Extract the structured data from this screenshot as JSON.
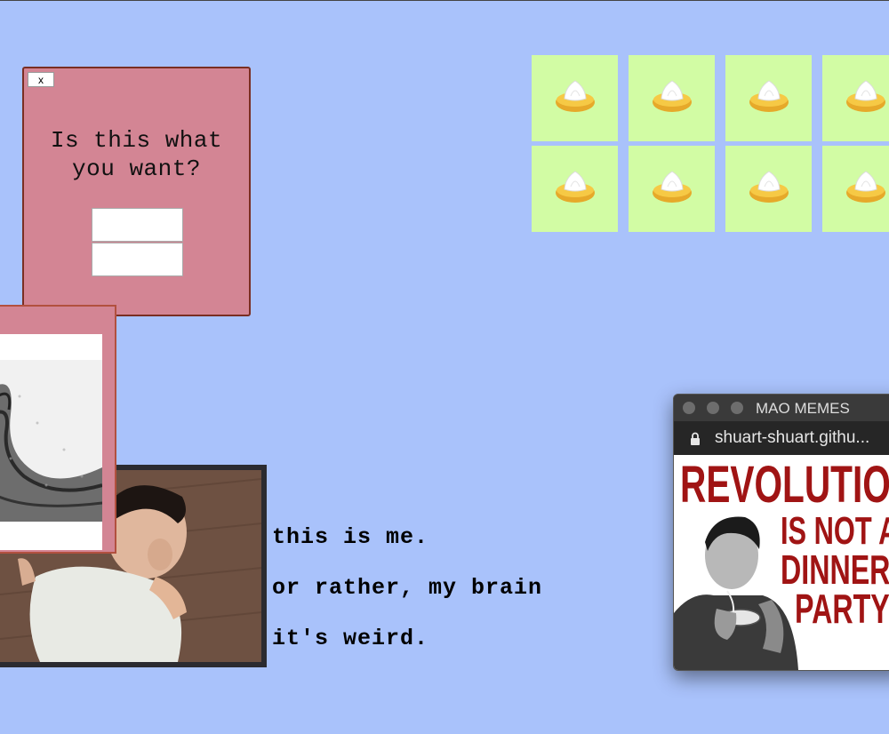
{
  "dialog": {
    "close_label": "x",
    "question_line1": "Is this what",
    "question_line2": "you want?"
  },
  "caption": {
    "line1": "this is me.",
    "line2": "or rather, my brain",
    "line3": "it's weird."
  },
  "tiles": {
    "count": 8,
    "icon": "lemon-meringue-tart-icon",
    "tile_color": "#d2fca4"
  },
  "mao_window": {
    "title": "MAO MEMES",
    "url": "shuart-shuart.githu...",
    "poster": {
      "line1": "REVOLUTION",
      "line2": "IS NOT A",
      "line3": "DINNER",
      "line4": "PARTY"
    }
  },
  "colors": {
    "background": "#a9c2fb",
    "dialog": "#d38594",
    "poster_red": "#a01414"
  }
}
